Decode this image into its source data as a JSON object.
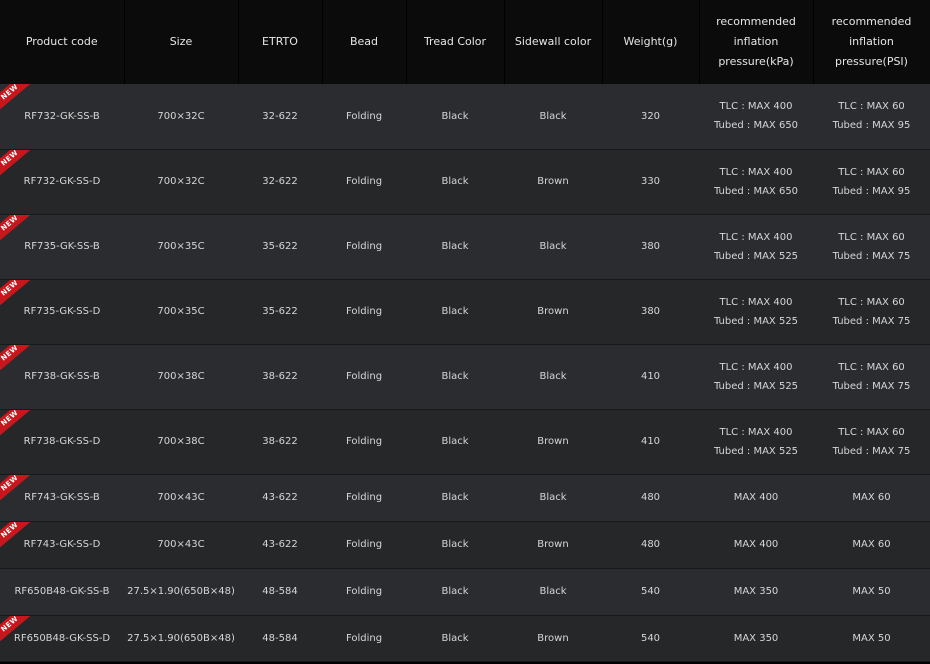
{
  "headers": [
    "Product code",
    "Size",
    "ETRTO",
    "Bead",
    "Tread Color",
    "Sidewall color",
    "Weight(g)",
    [
      "recommended",
      "inflation",
      "pressure(kPa)"
    ],
    [
      "recommended",
      "inflation",
      "pressure(PSI)"
    ]
  ],
  "badge": "NEW",
  "rows": [
    {
      "code": "RF732-GK-SS-B",
      "size": "700×32C",
      "etrto": "32-622",
      "bead": "Folding",
      "tread": "Black",
      "sidewall": "Black",
      "weight": "320",
      "kpa": [
        "TLC : MAX 400",
        "Tubed : MAX 650"
      ],
      "psi": [
        "TLC : MAX 60",
        "Tubed : MAX 95"
      ],
      "isNew": true
    },
    {
      "code": "RF732-GK-SS-D",
      "size": "700×32C",
      "etrto": "32-622",
      "bead": "Folding",
      "tread": "Black",
      "sidewall": "Brown",
      "weight": "330",
      "kpa": [
        "TLC : MAX 400",
        "Tubed : MAX 650"
      ],
      "psi": [
        "TLC : MAX 60",
        "Tubed : MAX 95"
      ],
      "isNew": true
    },
    {
      "code": "RF735-GK-SS-B",
      "size": "700×35C",
      "etrto": "35-622",
      "bead": "Folding",
      "tread": "Black",
      "sidewall": "Black",
      "weight": "380",
      "kpa": [
        "TLC : MAX 400",
        "Tubed : MAX 525"
      ],
      "psi": [
        "TLC : MAX 60",
        "Tubed : MAX 75"
      ],
      "isNew": true
    },
    {
      "code": "RF735-GK-SS-D",
      "size": "700×35C",
      "etrto": "35-622",
      "bead": "Folding",
      "tread": "Black",
      "sidewall": "Brown",
      "weight": "380",
      "kpa": [
        "TLC : MAX 400",
        "Tubed : MAX 525"
      ],
      "psi": [
        "TLC : MAX 60",
        "Tubed : MAX 75"
      ],
      "isNew": true
    },
    {
      "code": "RF738-GK-SS-B",
      "size": "700×38C",
      "etrto": "38-622",
      "bead": "Folding",
      "tread": "Black",
      "sidewall": "Black",
      "weight": "410",
      "kpa": [
        "TLC : MAX 400",
        "Tubed : MAX 525"
      ],
      "psi": [
        "TLC : MAX 60",
        "Tubed : MAX 75"
      ],
      "isNew": true
    },
    {
      "code": "RF738-GK-SS-D",
      "size": "700×38C",
      "etrto": "38-622",
      "bead": "Folding",
      "tread": "Black",
      "sidewall": "Brown",
      "weight": "410",
      "kpa": [
        "TLC : MAX 400",
        "Tubed : MAX 525"
      ],
      "psi": [
        "TLC : MAX 60",
        "Tubed : MAX 75"
      ],
      "isNew": true
    },
    {
      "code": "RF743-GK-SS-B",
      "size": "700×43C",
      "etrto": "43-622",
      "bead": "Folding",
      "tread": "Black",
      "sidewall": "Black",
      "weight": "480",
      "kpa": [
        "MAX 400"
      ],
      "psi": [
        "MAX 60"
      ],
      "isNew": true
    },
    {
      "code": "RF743-GK-SS-D",
      "size": "700×43C",
      "etrto": "43-622",
      "bead": "Folding",
      "tread": "Black",
      "sidewall": "Brown",
      "weight": "480",
      "kpa": [
        "MAX 400"
      ],
      "psi": [
        "MAX 60"
      ],
      "isNew": true
    },
    {
      "code": "RF650B48-GK-SS-B",
      "size": "27.5×1.90(650B×48)",
      "etrto": "48-584",
      "bead": "Folding",
      "tread": "Black",
      "sidewall": "Black",
      "weight": "540",
      "kpa": [
        "MAX 350"
      ],
      "psi": [
        "MAX 50"
      ],
      "isNew": false
    },
    {
      "code": "RF650B48-GK-SS-D",
      "size": "27.5×1.90(650B×48)",
      "etrto": "48-584",
      "bead": "Folding",
      "tread": "Black",
      "sidewall": "Brown",
      "weight": "540",
      "kpa": [
        "MAX 350"
      ],
      "psi": [
        "MAX 50"
      ],
      "isNew": true
    }
  ]
}
